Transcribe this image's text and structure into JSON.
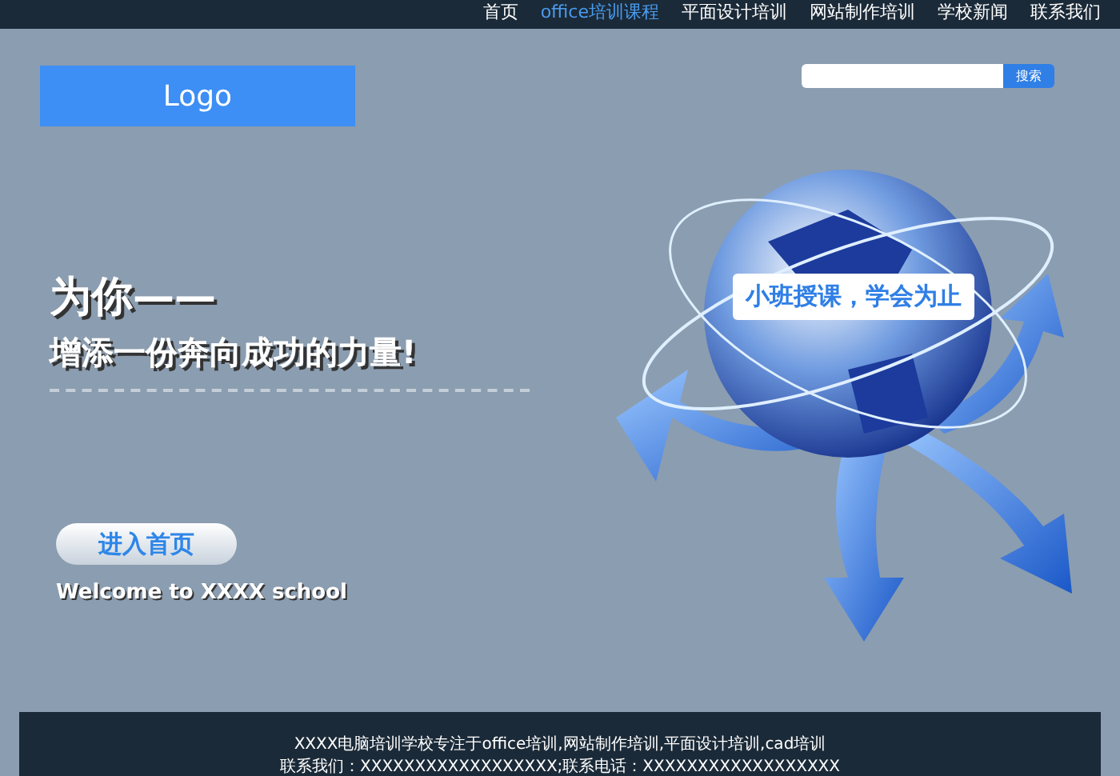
{
  "nav": [
    {
      "label": "首页",
      "selected": false
    },
    {
      "label": "office培训课程",
      "selected": true
    },
    {
      "label": "平面设计培训",
      "selected": false
    },
    {
      "label": "网站制作培训",
      "selected": false
    },
    {
      "label": "学校新闻",
      "selected": false
    },
    {
      "label": "联系我们",
      "selected": false
    }
  ],
  "logo": "Logo",
  "search": {
    "button": "搜索"
  },
  "hero": {
    "title": "为你——",
    "subtitle": "增添一份奔向成功的力量!",
    "button": "进入首页",
    "welcome": "Welcome to XXXX school",
    "badge": "小班授课，学会为止"
  },
  "footer": {
    "lines": [
      "XXXX电脑培训学校专注于office培训,网站制作培训,平面设计培训,cad培训",
      "联系我们：XXXXXXXXXXXXXXXXXX;联系电话：XXXXXXXXXXXXXXXXXX"
    ]
  }
}
